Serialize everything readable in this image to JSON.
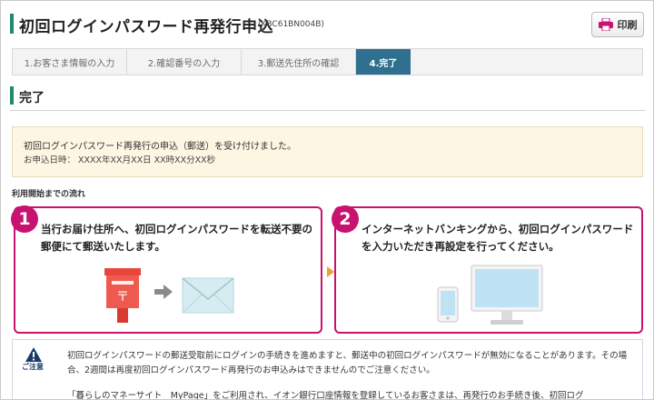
{
  "header": {
    "title": "初回ログインパスワード再発行申込",
    "code": "(KBC61BN004B)",
    "print_label": "印刷"
  },
  "stepper": {
    "steps": [
      "1.お客さま情報の入力",
      "2.確認番号の入力",
      "3.郵送先住所の確認",
      "4.完了"
    ],
    "current_step": 4
  },
  "section": {
    "title": "完了"
  },
  "notice": {
    "line1": "初回ログインパスワード再発行の申込（郵送）を受け付けました。",
    "line2": "お申込日時： XXXX年XX月XX日 XX時XX分XX秒"
  },
  "flow": {
    "label": "利用開始までの流れ",
    "cards": [
      {
        "number": "1",
        "text": "当行お届け住所へ、初回ログインパスワードを転送不要の郵便にて郵送いたします。",
        "icons": [
          "postbox-icon",
          "arrow-right-icon",
          "envelope-icon"
        ]
      },
      {
        "number": "2",
        "text": "インターネットバンキングから、初回ログインパスワードを入力いただき再設定を行ってください。",
        "icons": [
          "smartphone-icon",
          "monitor-icon"
        ]
      }
    ]
  },
  "caution": {
    "label": "ご注意",
    "text1": "初回ログインパスワードの郵送受取前にログインの手続きを進めますと、郵送中の初回ログインパスワードが無効になることがあります。その場合、2週間は再度初回ログインパスワード再発行のお申込みはできませんのでご注意ください。",
    "text2": "「暮らしのマネーサイト　MyPage」をご利用され、イオン銀行口座情報を登録しているお客さまは、再発行のお手続き後、初回ログ"
  },
  "colors": {
    "accent_green": "#1f8a70",
    "step_active": "#2f6f8f",
    "magenta": "#c8126f",
    "notice_bg": "#fcf6e2",
    "flow_arrow": "#f0a030",
    "postbox_red": "#e8453c",
    "envelope": "#d6ecf0",
    "device_blue": "#bfe3f5"
  }
}
